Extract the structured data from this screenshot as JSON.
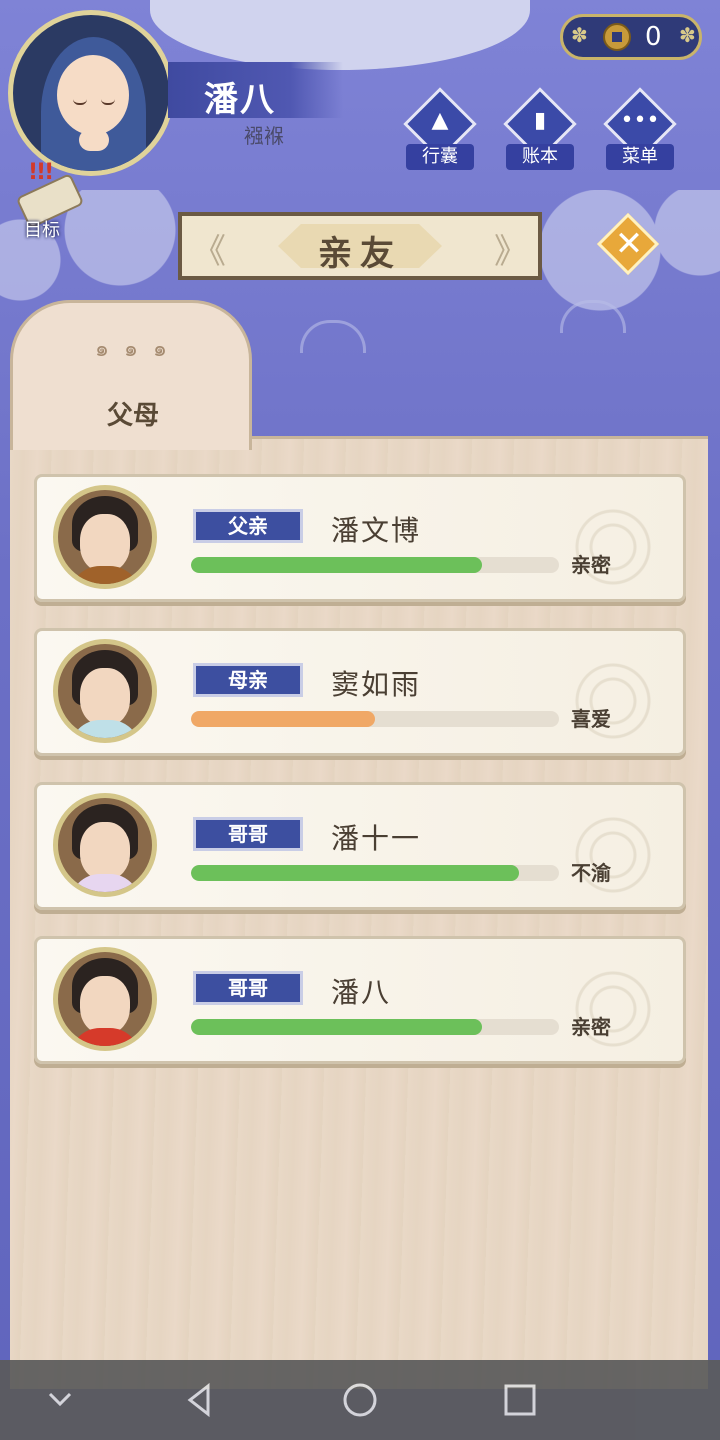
{
  "player": {
    "name": "潘八",
    "status": "襁褓",
    "goal_label": "目标"
  },
  "currency": {
    "icon": "coin-icon",
    "value": "0"
  },
  "top_menu": [
    {
      "label": "行囊",
      "icon": "bag-icon"
    },
    {
      "label": "账本",
      "icon": "ledger-icon"
    },
    {
      "label": "菜单",
      "icon": "more-icon"
    }
  ],
  "title": "亲友",
  "tab_label": "父母",
  "relatives": [
    {
      "role": "父亲",
      "name": "潘文博",
      "relation": "亲密",
      "affinity": 0.79,
      "bar_color": "#6cc05a"
    },
    {
      "role": "母亲",
      "name": "窦如雨",
      "relation": "喜爱",
      "affinity": 0.5,
      "bar_color": "#f0a866"
    },
    {
      "role": "哥哥",
      "name": "潘十一",
      "relation": "不渝",
      "affinity": 0.89,
      "bar_color": "#6cc05a"
    },
    {
      "role": "哥哥",
      "name": "潘八",
      "relation": "亲密",
      "affinity": 0.79,
      "bar_color": "#6cc05a"
    }
  ],
  "nav": [
    "chevron-down-icon",
    "back-icon",
    "home-icon",
    "recents-icon"
  ]
}
